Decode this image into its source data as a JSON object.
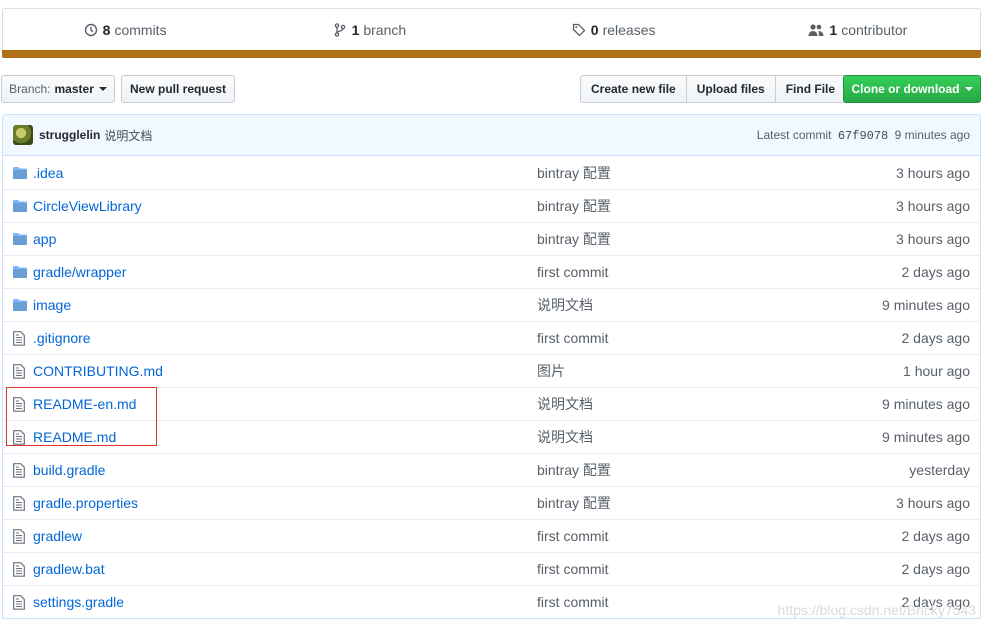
{
  "summary": {
    "commits": {
      "count": "8",
      "label": "commits",
      "icon": "history-icon"
    },
    "branches": {
      "count": "1",
      "label": "branch",
      "icon": "branch-icon"
    },
    "releases": {
      "count": "0",
      "label": "releases",
      "icon": "tag-icon"
    },
    "contributors": {
      "count": "1",
      "label": "contributor",
      "icon": "people-icon"
    },
    "language_bar_color": "#b07219"
  },
  "toolbar": {
    "branch_prefix": "Branch:",
    "branch_name": "master",
    "new_pull_request": "New pull request",
    "create_new_file": "Create new file",
    "upload_files": "Upload files",
    "find_file": "Find File",
    "clone_or_download": "Clone or download"
  },
  "latest_commit": {
    "author": "strugglelin",
    "message": "说明文档",
    "prefix": "Latest commit",
    "sha": "67f9078",
    "age": "9 minutes ago"
  },
  "files": [
    {
      "type": "dir",
      "name": ".idea",
      "message": "bintray 配置",
      "age": "3 hours ago"
    },
    {
      "type": "dir",
      "name": "CircleViewLibrary",
      "message": "bintray 配置",
      "age": "3 hours ago"
    },
    {
      "type": "dir",
      "name": "app",
      "message": "bintray 配置",
      "age": "3 hours ago"
    },
    {
      "type": "dir",
      "name": "gradle/wrapper",
      "message": "first commit",
      "age": "2 days ago"
    },
    {
      "type": "dir",
      "name": "image",
      "message": "说明文档",
      "age": "9 minutes ago"
    },
    {
      "type": "file",
      "name": ".gitignore",
      "message": "first commit",
      "age": "2 days ago"
    },
    {
      "type": "file",
      "name": "CONTRIBUTING.md",
      "message": "图片",
      "age": "1 hour ago"
    },
    {
      "type": "file",
      "name": "README-en.md",
      "message": "说明文档",
      "age": "9 minutes ago"
    },
    {
      "type": "file",
      "name": "README.md",
      "message": "说明文档",
      "age": "9 minutes ago"
    },
    {
      "type": "file",
      "name": "build.gradle",
      "message": "bintray 配置",
      "age": "yesterday"
    },
    {
      "type": "file",
      "name": "gradle.properties",
      "message": "bintray 配置",
      "age": "3 hours ago"
    },
    {
      "type": "file",
      "name": "gradlew",
      "message": "first commit",
      "age": "2 days ago"
    },
    {
      "type": "file",
      "name": "gradlew.bat",
      "message": "first commit",
      "age": "2 days ago"
    },
    {
      "type": "file",
      "name": "settings.gradle",
      "message": "first commit",
      "age": "2 days ago"
    }
  ],
  "watermark": "https://blog.csdn.net/Bricky7543",
  "colors": {
    "link": "#0366d6",
    "folder": "#79b8ff",
    "clone_button": "#28a745",
    "highlight_box": "#d9352e"
  }
}
